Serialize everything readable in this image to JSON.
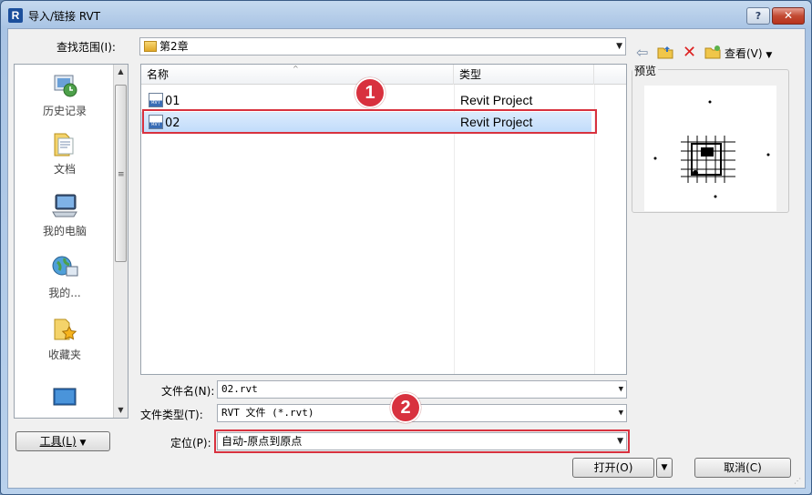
{
  "window": {
    "title": "导入/链接 RVT",
    "app_icon": "R",
    "help_label": "?",
    "close_label": "✕"
  },
  "lookin": {
    "label": "查找范围(I):",
    "value": "第2章"
  },
  "toolbar": {
    "view_label": "查看(V)"
  },
  "places": [
    {
      "label": "历史记录",
      "icon": "history-icon"
    },
    {
      "label": "文档",
      "icon": "documents-icon"
    },
    {
      "label": "我的电脑",
      "icon": "computer-icon"
    },
    {
      "label": "我的...",
      "icon": "network-icon"
    },
    {
      "label": "收藏夹",
      "icon": "favorites-icon"
    }
  ],
  "filelist": {
    "columns": [
      "名称",
      "类型"
    ],
    "rows": [
      {
        "name": "01",
        "type": "Revit Project",
        "selected": false
      },
      {
        "name": "02",
        "type": "Revit Project",
        "selected": true
      }
    ]
  },
  "preview": {
    "label": "预览"
  },
  "filename": {
    "label": "文件名(N):",
    "value": "02.rvt"
  },
  "filetype": {
    "label": "文件类型(T):",
    "value": "RVT 文件 (*.rvt)"
  },
  "position": {
    "label": "定位(P):",
    "value": "自动-原点到原点"
  },
  "tools_button": "工具(L)",
  "open_button": "打开(O)",
  "cancel_button": "取消(C)",
  "callouts": [
    "1",
    "2"
  ],
  "colors": {
    "highlight": "#d8313e",
    "selection": "#c1dcfb"
  }
}
